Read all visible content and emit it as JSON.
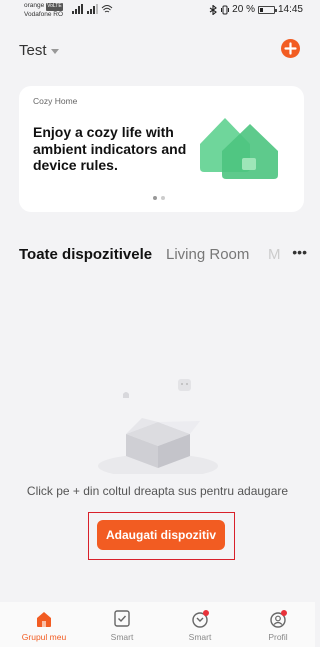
{
  "status_bar": {
    "carrier_line1": "orange",
    "volte_badge": "VoLTE",
    "carrier_line2": "Vodafone RO",
    "battery_percent": "20 %",
    "battery_level": 0.2,
    "time": "14:45"
  },
  "header": {
    "home_name": "Test"
  },
  "banner": {
    "tag": "Cozy Home",
    "text": "Enjoy a cozy life with ambient indicators and device rules."
  },
  "tabs": [
    {
      "label": "Toate dispozitivele"
    },
    {
      "label": "Living Room"
    },
    {
      "label": "M"
    }
  ],
  "more_label": "•••",
  "empty_state": {
    "message": "Click pe + din coltul dreapta sus pentru adaugare",
    "button_label": "Adaugati dispozitiv"
  },
  "bottom_nav": [
    {
      "label": "Grupul meu",
      "icon": "home-icon"
    },
    {
      "label": "Smart",
      "icon": "checkbox-icon"
    },
    {
      "label": "Smart",
      "icon": "mall-icon"
    },
    {
      "label": "Profil",
      "icon": "profile-icon"
    }
  ],
  "colors": {
    "accent": "#f25c22",
    "highlight_border": "#d8202a",
    "background": "#f3f3f5"
  }
}
